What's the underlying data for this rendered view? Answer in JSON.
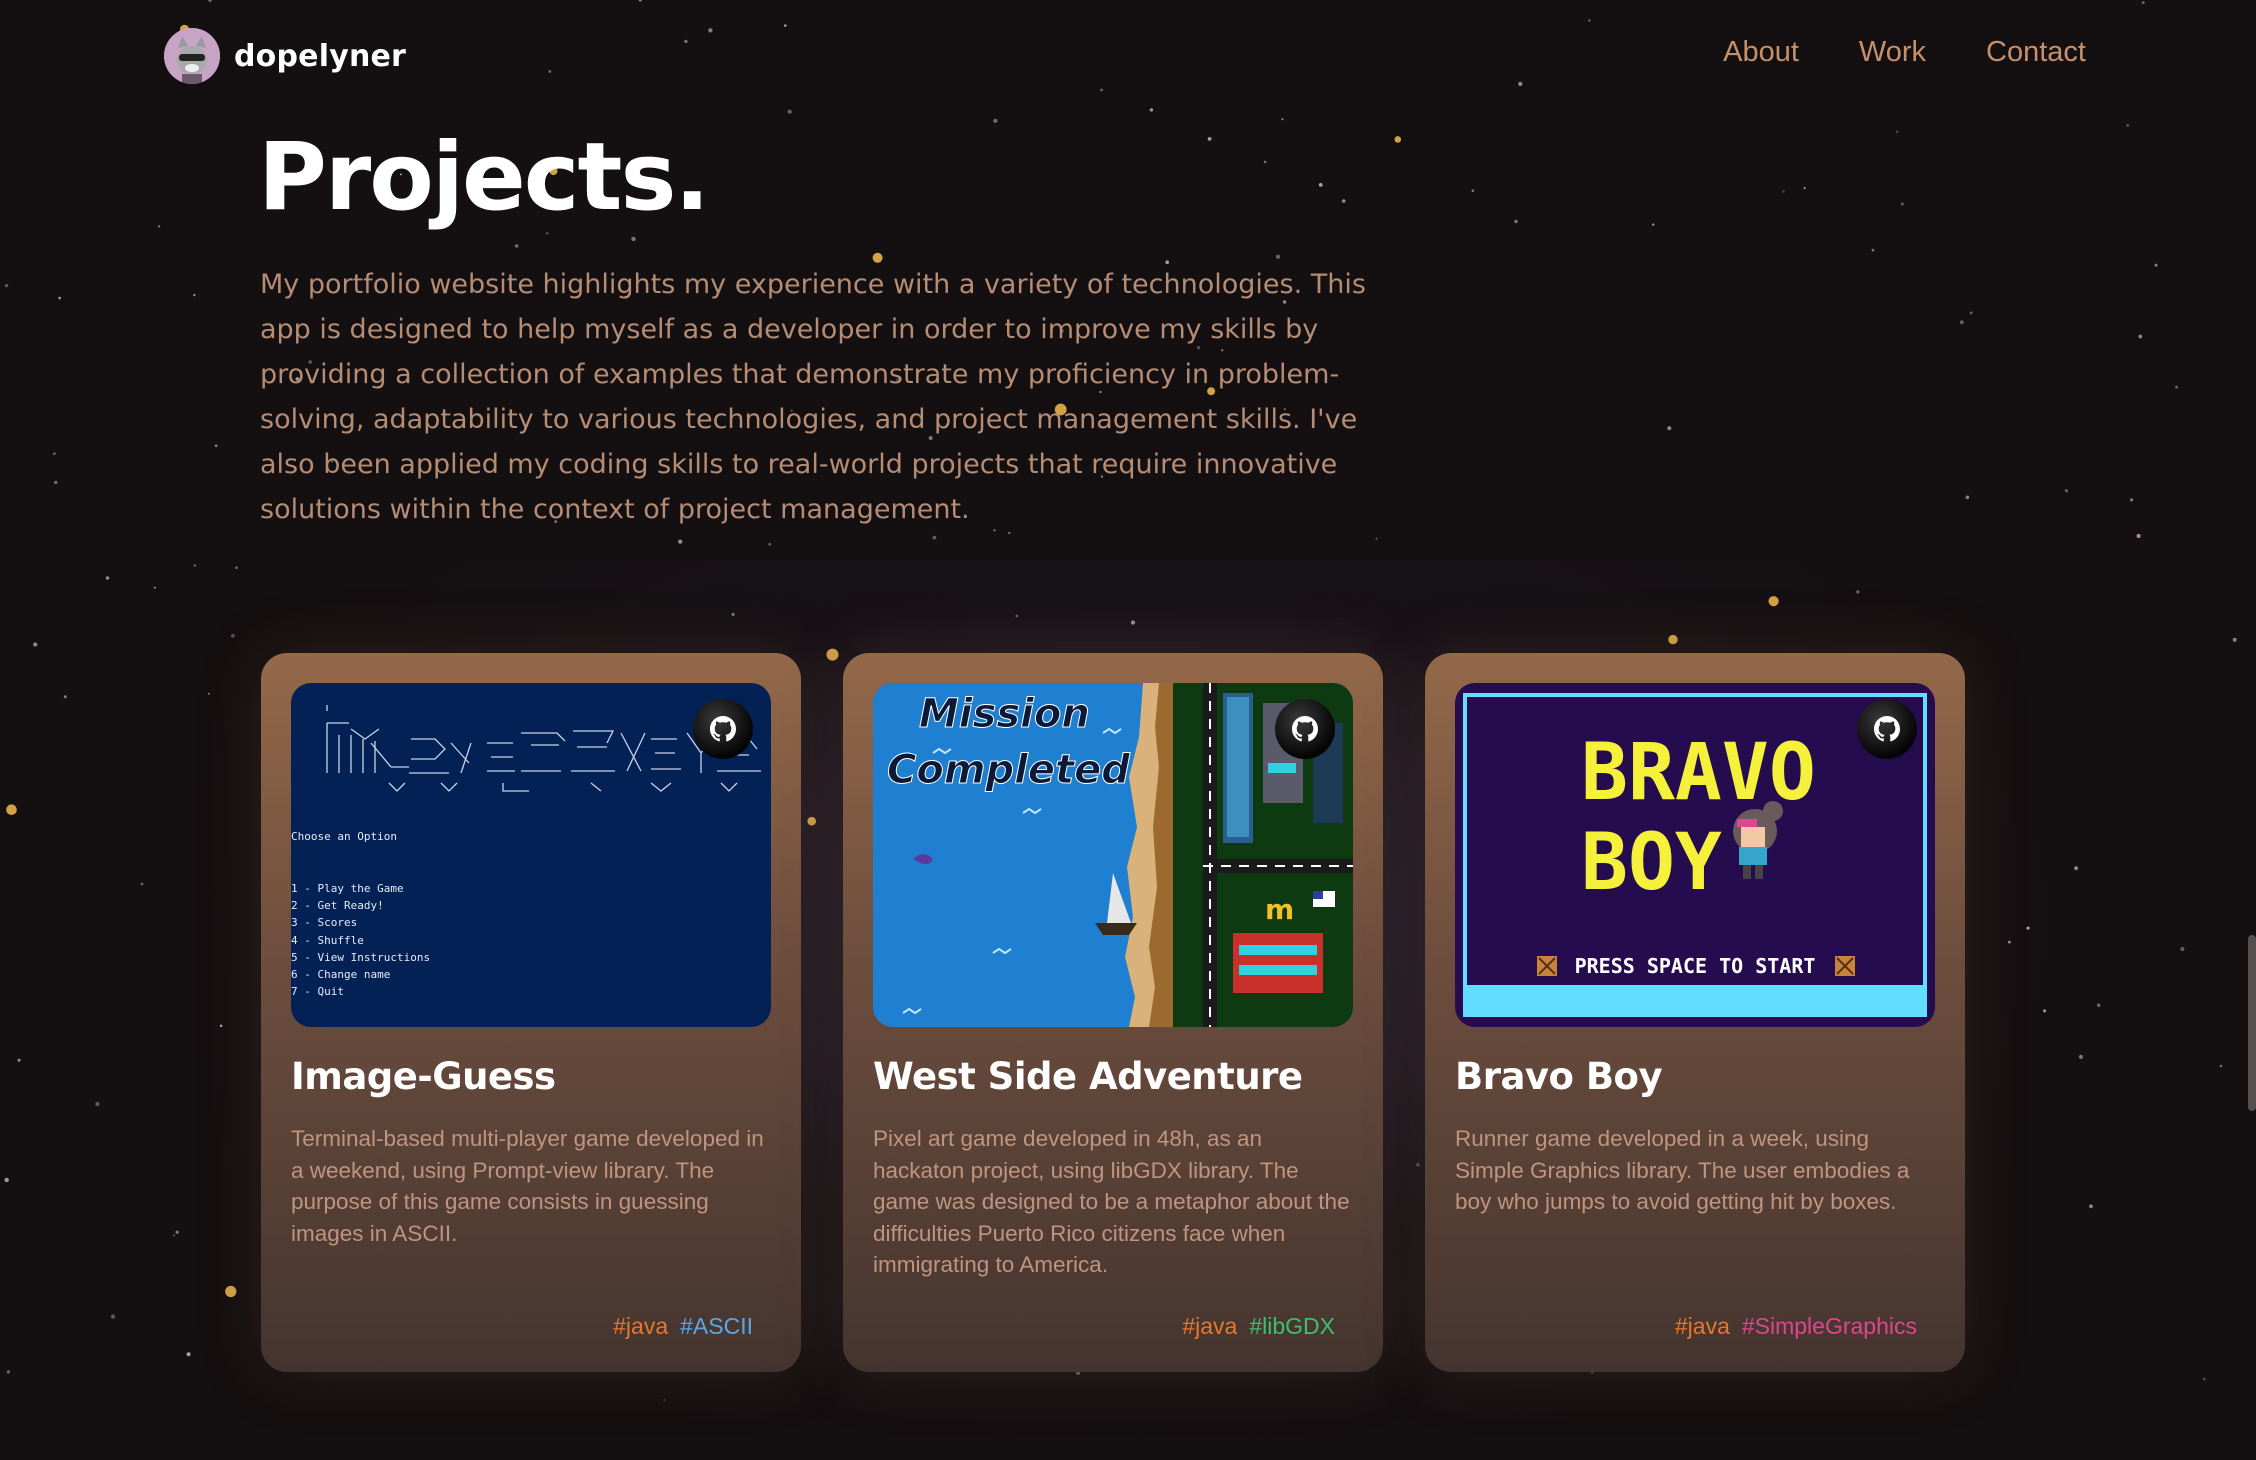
{
  "nav": {
    "brand": "dopelyner",
    "links": [
      "About",
      "Work",
      "Contact"
    ]
  },
  "section": {
    "title": "Projects.",
    "intro": "My portfolio website highlights my experience with a variety of technologies. This app is designed to help myself as a developer in order to improve my skills by providing a collection of examples that demonstrate my proficiency in problem-solving, adaptability to various technologies, and project management skills. I've also been applied my coding skills to real-world projects that require innovative solutions within the context of project management."
  },
  "projects": [
    {
      "name": "Image-Guess",
      "description": "Terminal-based multi-player game developed in a weekend, using Prompt-view library. The purpose of this game consists in guessing images in ASCII.",
      "tags": [
        {
          "label": "#java",
          "color": "#e8772e"
        },
        {
          "label": "#ASCII",
          "color": "#5aa7e8"
        }
      ],
      "screen": {
        "prompt": "Choose an Option",
        "options": [
          "1 - Play the Game",
          "2 - Get Ready!",
          "3 - Scores",
          "4 - Shuffle",
          "5 - View Instructions",
          "6 - Change name",
          "7 - Quit"
        ]
      }
    },
    {
      "name": "West Side Adventure",
      "description": "Pixel art game developed in 48h, as an hackaton project, using libGDX library. The game was designed to be a metaphor about the difficulties Puerto Rico citizens face when immigrating to America.",
      "tags": [
        {
          "label": "#java",
          "color": "#e8772e"
        },
        {
          "label": "#libGDX",
          "color": "#3fbf6e"
        }
      ],
      "screen": {
        "line1": "Mission",
        "line2": "Completed"
      }
    },
    {
      "name": "Bravo Boy",
      "description": "Runner game developed in a week, using Simple Graphics library. The user embodies a boy who jumps to avoid getting hit by boxes.",
      "tags": [
        {
          "label": "#java",
          "color": "#e8772e"
        },
        {
          "label": "#SimpleGraphics",
          "color": "#e0458f"
        }
      ],
      "screen": {
        "line1": "BRAVO",
        "line2": "BOY",
        "prompt": "PRESS SPACE TO START"
      }
    }
  ]
}
